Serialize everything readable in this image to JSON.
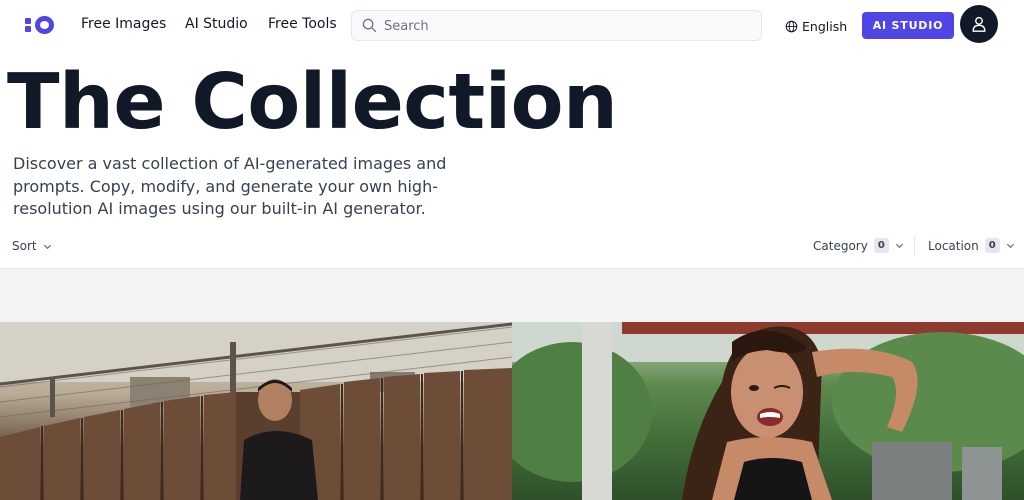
{
  "header": {
    "nav": [
      "Free Images",
      "AI Studio",
      "Free Tools"
    ],
    "search_placeholder": "Search",
    "language": "English",
    "ai_button": "AI STUDIO"
  },
  "hero": {
    "title": "The Collection",
    "description": "Discover a vast collection of AI-generated images and prompts. Copy, modify, and generate your own high-resolution AI images using our built-in AI generator."
  },
  "filters": {
    "sort_label": "Sort",
    "category_label": "Category",
    "category_count": "0",
    "location_label": "Location",
    "location_count": "0"
  },
  "colors": {
    "accent": "#4f46e5",
    "text": "#111827",
    "muted_band": "#f3f4f6"
  },
  "icons": {
    "logo": "dot-circle-logo",
    "search": "magnifier-icon",
    "language": "globe-icon",
    "avatar": "user-icon",
    "chevron": "chevron-down-icon"
  }
}
